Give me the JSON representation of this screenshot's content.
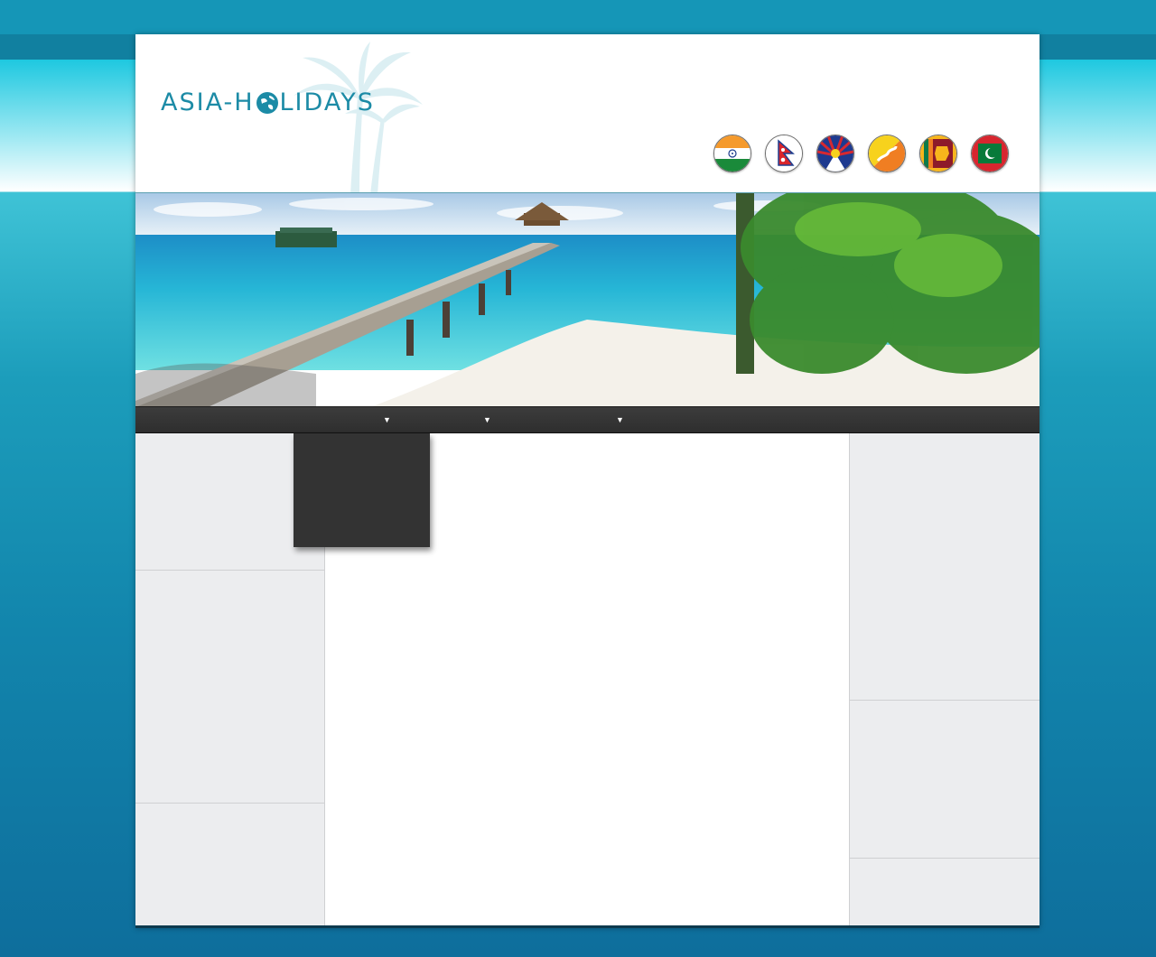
{
  "site": {
    "logo_text_left": "ASIA-H",
    "logo_text_right": "LIDAYS",
    "brand_color": "#1c8ba6"
  },
  "flags": [
    {
      "icon": "india-flag-icon"
    },
    {
      "icon": "nepal-flag-icon"
    },
    {
      "icon": "tibet-flag-icon"
    },
    {
      "icon": "bhutan-flag-icon"
    },
    {
      "icon": "sri-lanka-flag-icon"
    },
    {
      "icon": "maldives-flag-icon"
    }
  ],
  "nav": {
    "items": [
      {
        "label": "",
        "arrow": "▼"
      },
      {
        "label": "",
        "arrow": "▼"
      },
      {
        "label": "",
        "arrow": "▼"
      }
    ]
  },
  "colors": {
    "nav_bg": "#333333",
    "sidebar_bg": "#ecedef",
    "page_bg": "#1596b7"
  }
}
